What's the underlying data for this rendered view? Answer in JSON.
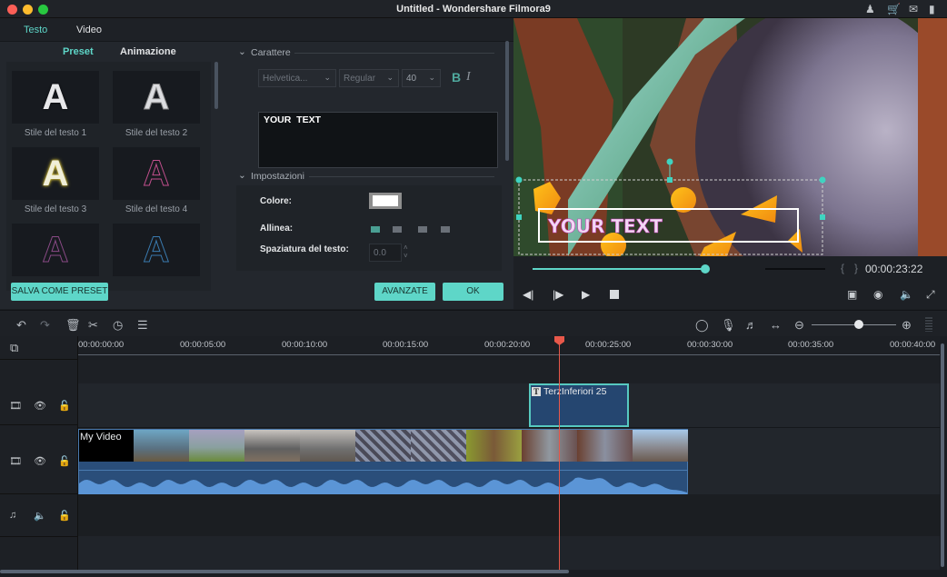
{
  "window": {
    "title": "Untitled - Wondershare Filmora9",
    "controls": [
      "close",
      "minimize",
      "maximize"
    ],
    "right_icons": [
      "account-icon",
      "cart-icon",
      "mail-icon",
      "notification-icon"
    ]
  },
  "editor": {
    "tabs": [
      {
        "label": "Testo",
        "active": true
      },
      {
        "label": "Video",
        "active": false
      }
    ],
    "subtabs": [
      {
        "label": "Preset",
        "active": true
      },
      {
        "label": "Animazione",
        "active": false
      }
    ],
    "presets": [
      {
        "label": "Stile del testo 1",
        "glyph": "A",
        "style": "white"
      },
      {
        "label": "Stile del testo 2",
        "glyph": "A",
        "style": "white-outline"
      },
      {
        "label": "Stile del testo 3",
        "glyph": "A",
        "style": "yellow-glow"
      },
      {
        "label": "Stile del testo 4",
        "glyph": "A",
        "style": "pink-outline"
      },
      {
        "label": "",
        "glyph": "A",
        "style": "purple-outline"
      },
      {
        "label": "",
        "glyph": "A",
        "style": "blue-outline"
      }
    ],
    "save_preset_label": "SALVA COME PRESET",
    "character": {
      "section_label": "Carattere",
      "font": "Helvetica...",
      "weight": "Regular",
      "size": "40",
      "bold_label": "B",
      "italic_label": "I",
      "text": "YOUR  TEXT"
    },
    "settings": {
      "section_label": "Impostazioni",
      "color_label": "Colore:",
      "color_value": "#ffffff",
      "align_label": "Allinea:",
      "align_options": [
        "left",
        "center",
        "right",
        "justify"
      ],
      "align_selected": "left",
      "spacing_label": "Spaziatura del testo:",
      "spacing_value": "0.0"
    },
    "advanced_label": "AVANZATE",
    "ok_label": "OK"
  },
  "preview": {
    "overlay_text": "YOUR TEXT",
    "progress": 0.59,
    "timecode": "00:00:23:22",
    "bracket_left": "{",
    "bracket_right": "}"
  },
  "player_controls": {
    "left": [
      "prev-frame-icon",
      "next-frame-icon",
      "play-icon",
      "stop-icon"
    ],
    "right": [
      "render-settings-icon",
      "snapshot-icon",
      "volume-icon",
      "fullscreen-icon"
    ]
  },
  "toolbar": {
    "left": [
      "undo-icon",
      "redo-icon",
      "delete-icon",
      "cut-icon",
      "speed-icon",
      "adjust-icon"
    ],
    "right": [
      "marker-icon",
      "voiceover-icon",
      "audio-mixer-icon",
      "fit-icon",
      "zoom-out-icon",
      "zoom-in-icon"
    ],
    "zoom_level": 0.75
  },
  "timeline": {
    "ruler": [
      "00:00:00:00",
      "00:00:05:00",
      "00:00:10:00",
      "00:00:15:00",
      "00:00:20:00",
      "00:00:25:00",
      "00:00:30:00",
      "00:00:35:00",
      "00:00:40:00"
    ],
    "playhead_time": "00:00:23:22",
    "tracks": [
      {
        "type": "title",
        "icons": [
          "film-icon",
          "eye-icon",
          "lock-icon"
        ],
        "clips": [
          {
            "label": "TerzInferiori 25",
            "start_s": 22.0,
            "end_s": 27.0
          }
        ]
      },
      {
        "type": "video",
        "icons": [
          "film-icon",
          "eye-icon",
          "lock-icon"
        ],
        "clips": [
          {
            "label": "My Video",
            "start_s": 0,
            "end_s": 30.0
          }
        ]
      },
      {
        "type": "audio",
        "icons": [
          "music-icon",
          "speaker-icon",
          "lock-icon"
        ],
        "clips": []
      }
    ]
  },
  "colors": {
    "accent": "#5ed6c8",
    "playhead": "#e8584a",
    "clip_blue": "#2a4e7a",
    "waveform": "#5b95d6"
  }
}
